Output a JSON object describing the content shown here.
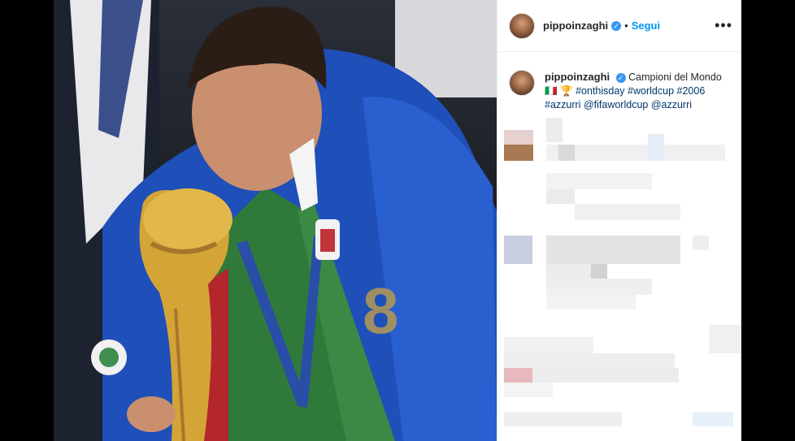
{
  "post": {
    "username": "pippoinzaghi",
    "follow_label": "Segui",
    "separator": "•",
    "more_label": "•••",
    "verified_glyph": "✓",
    "caption": {
      "text": "Campioni del Mondo",
      "line2_prefix": "🇮🇹 🏆",
      "tags": [
        "#onthisday",
        "#worldcup",
        "#2006",
        "#azzurri",
        "@fifaworldcup",
        "@azzurri"
      ]
    }
  },
  "icons": {
    "avatar": "avatar-image",
    "verified": "verified-badge-icon",
    "more": "more-options-icon"
  },
  "colors": {
    "accent": "#0095f6",
    "verified": "#3897f0",
    "tag": "#00376b",
    "jersey": "#1f4fb8",
    "trophy": "#d4a437"
  }
}
